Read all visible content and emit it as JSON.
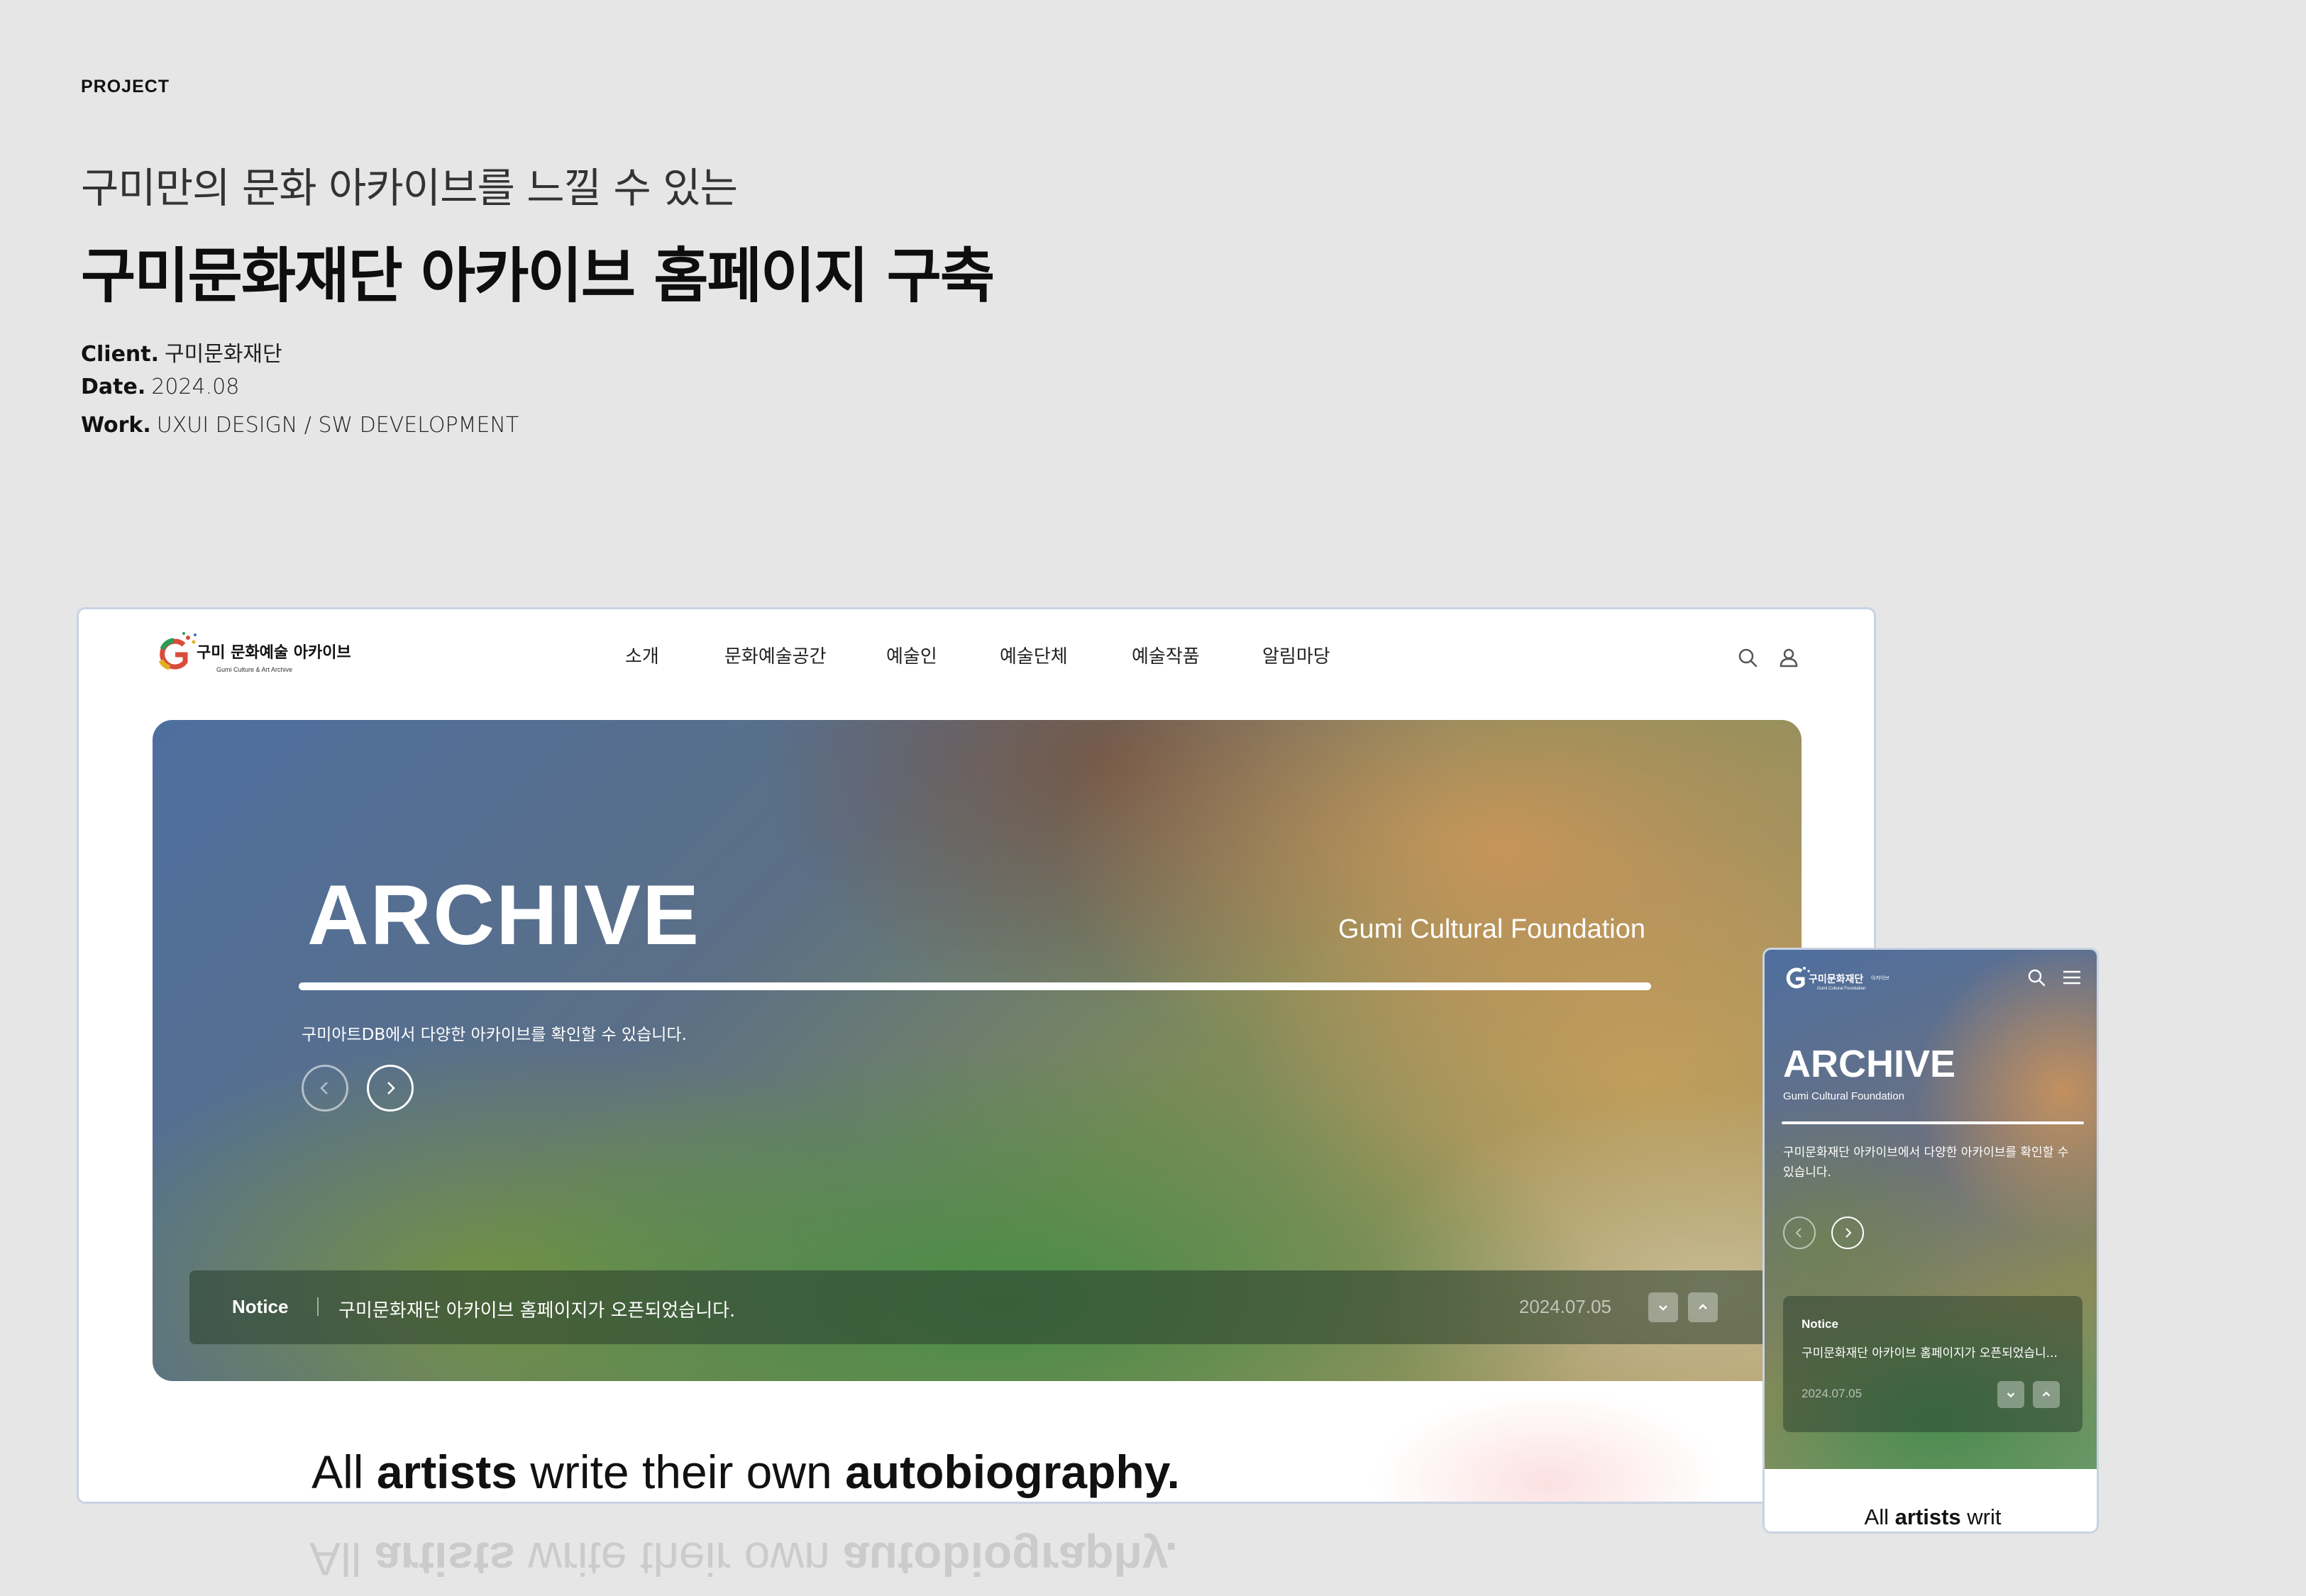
{
  "project": {
    "label": "PROJECT",
    "subtitle": "구미만의 문화 아카이브를 느낄 수 있는",
    "title": "구미문화재단 아카이브 홈페이지 구축",
    "client_key": "Client.",
    "client_value": "구미문화재단",
    "date_key": "Date.",
    "date_value": "2024.08",
    "work_key": "Work.",
    "work_value": "UXUI DESIGN / SW DEVELOPMENT"
  },
  "desktop": {
    "logo": {
      "name": "구미 문화예술 아카이브",
      "sub": "Gumi Culture & Art Archive"
    },
    "nav": [
      "소개",
      "문화예술공간",
      "예술인",
      "예술단체",
      "예술작품",
      "알림마당"
    ],
    "icons": [
      "search-icon",
      "user-icon"
    ],
    "hero": {
      "title": "ARCHIVE",
      "tagline": "Gumi Cultural Foundation",
      "description": "구미아트DB에서 다양한 아카이브를 확인할 수 있습니다."
    },
    "notice": {
      "label": "Notice",
      "text": "구미문화재단 아카이브 홈페이지가 오픈되었습니다.",
      "date": "2024.07.05"
    },
    "motto": {
      "p1": "All ",
      "b1": "artists",
      "p2": " write their own ",
      "b2": "autobiography."
    }
  },
  "mobile": {
    "logo": {
      "name": "구미문화재단",
      "tag": "아카이브",
      "sub": "Gumi Cultural Foundation"
    },
    "hero": {
      "title": "ARCHIVE",
      "tagline": "Gumi Cultural Foundation",
      "description": "구미문화재단 아카이브에서 다양한 아카이브를 확인할 수 있습니다."
    },
    "notice": {
      "label": "Notice",
      "text": "구미문화재단 아카이브 홈페이지가 오픈되었습니...",
      "date": "2024.07.05"
    },
    "motto": {
      "p1": "All ",
      "b1": "artists",
      "p2": " writ"
    }
  },
  "colors": {
    "background": "#e6e6e6",
    "mockup_border": "#c9d3e3",
    "hero_blue": "#4e6f9f",
    "hero_green": "#468c46",
    "hero_orange": "#d2965a"
  }
}
